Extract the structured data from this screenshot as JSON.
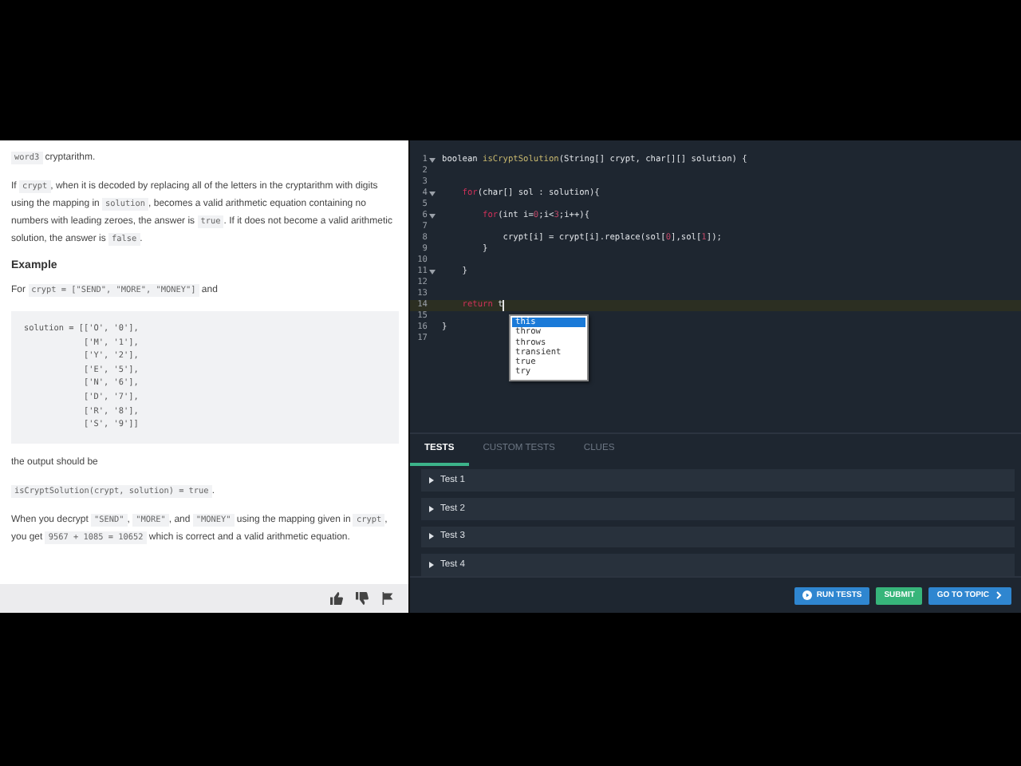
{
  "description": {
    "blocks": [
      {
        "kind": "para",
        "parts": [
          {
            "kind": "code",
            "text": "word3"
          },
          {
            "kind": "text",
            "text": " cryptarithm."
          }
        ]
      },
      {
        "kind": "para",
        "parts": [
          {
            "kind": "text",
            "text": "If "
          },
          {
            "kind": "code",
            "text": "crypt"
          },
          {
            "kind": "text",
            "text": ", when it is decoded by replacing all of the letters in the cryptarithm with digits using the mapping in "
          },
          {
            "kind": "code",
            "text": "solution"
          },
          {
            "kind": "text",
            "text": ", becomes a valid arithmetic equation containing no numbers with leading zeroes, the answer is "
          },
          {
            "kind": "code",
            "text": "true"
          },
          {
            "kind": "text",
            "text": ". If it does not become a valid arithmetic solution, the answer is "
          },
          {
            "kind": "code",
            "text": "false"
          },
          {
            "kind": "text",
            "text": "."
          }
        ]
      },
      {
        "kind": "heading",
        "parts": [
          {
            "kind": "text",
            "text": "Example"
          }
        ]
      },
      {
        "kind": "para",
        "parts": [
          {
            "kind": "text",
            "text": "For "
          },
          {
            "kind": "code",
            "text": "crypt = [\"SEND\", \"MORE\", \"MONEY\"]"
          },
          {
            "kind": "text",
            "text": " and"
          }
        ]
      },
      {
        "kind": "pre",
        "lines": [
          "solution = [['O', '0'],",
          "            ['M', '1'],",
          "            ['Y', '2'],",
          "            ['E', '5'],",
          "            ['N', '6'],",
          "            ['D', '7'],",
          "            ['R', '8'],",
          "            ['S', '9']]"
        ]
      },
      {
        "kind": "para",
        "parts": [
          {
            "kind": "text",
            "text": "the output should be"
          }
        ]
      },
      {
        "kind": "para",
        "parts": [
          {
            "kind": "code",
            "text": "isCryptSolution(crypt, solution) = true"
          },
          {
            "kind": "text",
            "text": "."
          }
        ]
      },
      {
        "kind": "para",
        "parts": [
          {
            "kind": "text",
            "text": "When you decrypt "
          },
          {
            "kind": "code",
            "text": "\"SEND\""
          },
          {
            "kind": "text",
            "text": ", "
          },
          {
            "kind": "code",
            "text": "\"MORE\""
          },
          {
            "kind": "text",
            "text": ", and "
          },
          {
            "kind": "code",
            "text": "\"MONEY\""
          },
          {
            "kind": "text",
            "text": " using the mapping given in "
          },
          {
            "kind": "code",
            "text": "crypt"
          },
          {
            "kind": "text",
            "text": ", you get "
          },
          {
            "kind": "code",
            "text": "9567 + 1085 = 10652"
          },
          {
            "kind": "text",
            "text": " which is correct and a valid arithmetic equation."
          }
        ]
      }
    ]
  },
  "editor": {
    "lines": [
      {
        "number": "1",
        "fold": true,
        "current": false,
        "tokens": [
          {
            "kind": "plain",
            "text": "boolean "
          },
          {
            "kind": "name",
            "text": "isCryptSolution"
          },
          {
            "kind": "plain",
            "text": "(String[] crypt, char[][] solution) {"
          }
        ]
      },
      {
        "number": "2",
        "fold": false,
        "current": false
      },
      {
        "number": "3",
        "fold": false,
        "current": false
      },
      {
        "number": "4",
        "fold": true,
        "current": false,
        "tokens": [
          {
            "kind": "keyword",
            "text": "    for"
          },
          {
            "kind": "plain",
            "text": "(char[] sol : solution){"
          }
        ]
      },
      {
        "number": "5",
        "fold": false,
        "current": false
      },
      {
        "number": "6",
        "fold": true,
        "current": false,
        "tokens": [
          {
            "kind": "keyword",
            "text": "        for"
          },
          {
            "kind": "plain",
            "text": "(int i="
          },
          {
            "kind": "number",
            "text": "0"
          },
          {
            "kind": "plain",
            "text": ";i<"
          },
          {
            "kind": "number",
            "text": "3"
          },
          {
            "kind": "plain",
            "text": ";i++){"
          }
        ]
      },
      {
        "number": "7",
        "fold": false,
        "current": false
      },
      {
        "number": "8",
        "fold": false,
        "current": false,
        "tokens": [
          {
            "kind": "plain",
            "text": "            crypt[i] = crypt[i].replace(sol["
          },
          {
            "kind": "number",
            "text": "0"
          },
          {
            "kind": "plain",
            "text": "],sol["
          },
          {
            "kind": "number",
            "text": "1"
          },
          {
            "kind": "plain",
            "text": "]);"
          }
        ]
      },
      {
        "number": "9",
        "fold": false,
        "current": false,
        "tokens": [
          {
            "kind": "plain",
            "text": "        }"
          }
        ]
      },
      {
        "number": "10",
        "fold": false,
        "current": false
      },
      {
        "number": "11",
        "fold": true,
        "current": false,
        "tokens": [
          {
            "kind": "plain",
            "text": "    }"
          }
        ]
      },
      {
        "number": "12",
        "fold": false,
        "current": false
      },
      {
        "number": "13",
        "fold": false,
        "current": false
      },
      {
        "number": "14",
        "fold": false,
        "current": true,
        "tokens": [
          {
            "kind": "keyword",
            "text": "    return"
          },
          {
            "kind": "plain",
            "text": " t"
          }
        ]
      },
      {
        "number": "15",
        "fold": false,
        "current": false
      },
      {
        "number": "16",
        "fold": false,
        "current": false,
        "tokens": [
          {
            "kind": "plain",
            "text": "}"
          }
        ]
      },
      {
        "number": "17",
        "fold": false,
        "current": false
      }
    ],
    "autocomplete": [
      {
        "label": "this",
        "selected": true
      },
      {
        "label": "throw",
        "selected": false
      },
      {
        "label": "throws",
        "selected": false
      },
      {
        "label": "transient",
        "selected": false
      },
      {
        "label": "true",
        "selected": false
      },
      {
        "label": "try",
        "selected": false
      }
    ]
  },
  "tabs": [
    {
      "label": "TESTS",
      "selected": true
    },
    {
      "label": "CUSTOM TESTS",
      "selected": false
    },
    {
      "label": "CLUES",
      "selected": false
    }
  ],
  "tests": [
    {
      "label": "Test 1"
    },
    {
      "label": "Test 2"
    },
    {
      "label": "Test 3"
    },
    {
      "label": "Test 4"
    }
  ],
  "buttons": [
    {
      "kind": "run",
      "label": "RUN TESTS"
    },
    {
      "kind": "submit",
      "label": "SUBMIT"
    },
    {
      "kind": "topic",
      "label": "GO TO TOPIC"
    }
  ]
}
